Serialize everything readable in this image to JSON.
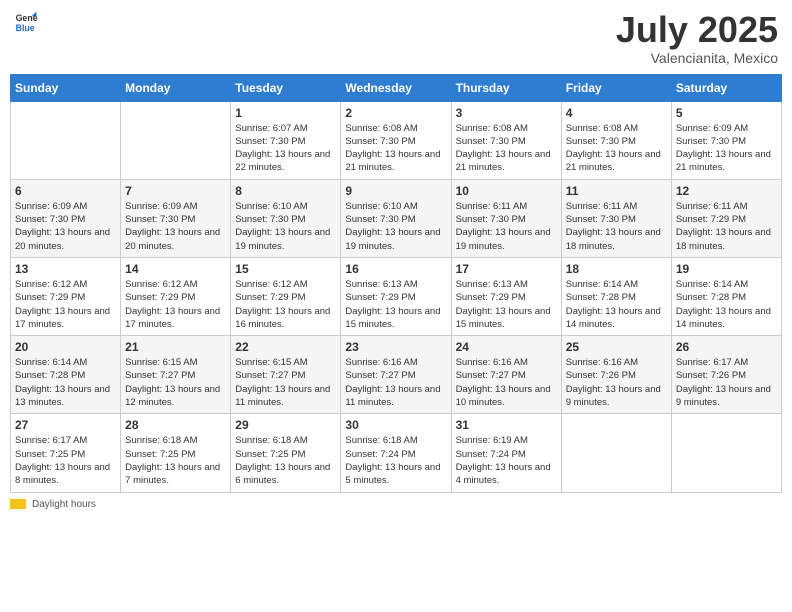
{
  "header": {
    "logo_general": "General",
    "logo_blue": "Blue",
    "month": "July 2025",
    "location": "Valencianita, Mexico"
  },
  "days_of_week": [
    "Sunday",
    "Monday",
    "Tuesday",
    "Wednesday",
    "Thursday",
    "Friday",
    "Saturday"
  ],
  "weeks": [
    [
      {
        "day": "",
        "info": ""
      },
      {
        "day": "",
        "info": ""
      },
      {
        "day": "1",
        "info": "Sunrise: 6:07 AM\nSunset: 7:30 PM\nDaylight: 13 hours and 22 minutes."
      },
      {
        "day": "2",
        "info": "Sunrise: 6:08 AM\nSunset: 7:30 PM\nDaylight: 13 hours and 21 minutes."
      },
      {
        "day": "3",
        "info": "Sunrise: 6:08 AM\nSunset: 7:30 PM\nDaylight: 13 hours and 21 minutes."
      },
      {
        "day": "4",
        "info": "Sunrise: 6:08 AM\nSunset: 7:30 PM\nDaylight: 13 hours and 21 minutes."
      },
      {
        "day": "5",
        "info": "Sunrise: 6:09 AM\nSunset: 7:30 PM\nDaylight: 13 hours and 21 minutes."
      }
    ],
    [
      {
        "day": "6",
        "info": "Sunrise: 6:09 AM\nSunset: 7:30 PM\nDaylight: 13 hours and 20 minutes."
      },
      {
        "day": "7",
        "info": "Sunrise: 6:09 AM\nSunset: 7:30 PM\nDaylight: 13 hours and 20 minutes."
      },
      {
        "day": "8",
        "info": "Sunrise: 6:10 AM\nSunset: 7:30 PM\nDaylight: 13 hours and 19 minutes."
      },
      {
        "day": "9",
        "info": "Sunrise: 6:10 AM\nSunset: 7:30 PM\nDaylight: 13 hours and 19 minutes."
      },
      {
        "day": "10",
        "info": "Sunrise: 6:11 AM\nSunset: 7:30 PM\nDaylight: 13 hours and 19 minutes."
      },
      {
        "day": "11",
        "info": "Sunrise: 6:11 AM\nSunset: 7:30 PM\nDaylight: 13 hours and 18 minutes."
      },
      {
        "day": "12",
        "info": "Sunrise: 6:11 AM\nSunset: 7:29 PM\nDaylight: 13 hours and 18 minutes."
      }
    ],
    [
      {
        "day": "13",
        "info": "Sunrise: 6:12 AM\nSunset: 7:29 PM\nDaylight: 13 hours and 17 minutes."
      },
      {
        "day": "14",
        "info": "Sunrise: 6:12 AM\nSunset: 7:29 PM\nDaylight: 13 hours and 17 minutes."
      },
      {
        "day": "15",
        "info": "Sunrise: 6:12 AM\nSunset: 7:29 PM\nDaylight: 13 hours and 16 minutes."
      },
      {
        "day": "16",
        "info": "Sunrise: 6:13 AM\nSunset: 7:29 PM\nDaylight: 13 hours and 15 minutes."
      },
      {
        "day": "17",
        "info": "Sunrise: 6:13 AM\nSunset: 7:29 PM\nDaylight: 13 hours and 15 minutes."
      },
      {
        "day": "18",
        "info": "Sunrise: 6:14 AM\nSunset: 7:28 PM\nDaylight: 13 hours and 14 minutes."
      },
      {
        "day": "19",
        "info": "Sunrise: 6:14 AM\nSunset: 7:28 PM\nDaylight: 13 hours and 14 minutes."
      }
    ],
    [
      {
        "day": "20",
        "info": "Sunrise: 6:14 AM\nSunset: 7:28 PM\nDaylight: 13 hours and 13 minutes."
      },
      {
        "day": "21",
        "info": "Sunrise: 6:15 AM\nSunset: 7:27 PM\nDaylight: 13 hours and 12 minutes."
      },
      {
        "day": "22",
        "info": "Sunrise: 6:15 AM\nSunset: 7:27 PM\nDaylight: 13 hours and 11 minutes."
      },
      {
        "day": "23",
        "info": "Sunrise: 6:16 AM\nSunset: 7:27 PM\nDaylight: 13 hours and 11 minutes."
      },
      {
        "day": "24",
        "info": "Sunrise: 6:16 AM\nSunset: 7:27 PM\nDaylight: 13 hours and 10 minutes."
      },
      {
        "day": "25",
        "info": "Sunrise: 6:16 AM\nSunset: 7:26 PM\nDaylight: 13 hours and 9 minutes."
      },
      {
        "day": "26",
        "info": "Sunrise: 6:17 AM\nSunset: 7:26 PM\nDaylight: 13 hours and 9 minutes."
      }
    ],
    [
      {
        "day": "27",
        "info": "Sunrise: 6:17 AM\nSunset: 7:25 PM\nDaylight: 13 hours and 8 minutes."
      },
      {
        "day": "28",
        "info": "Sunrise: 6:18 AM\nSunset: 7:25 PM\nDaylight: 13 hours and 7 minutes."
      },
      {
        "day": "29",
        "info": "Sunrise: 6:18 AM\nSunset: 7:25 PM\nDaylight: 13 hours and 6 minutes."
      },
      {
        "day": "30",
        "info": "Sunrise: 6:18 AM\nSunset: 7:24 PM\nDaylight: 13 hours and 5 minutes."
      },
      {
        "day": "31",
        "info": "Sunrise: 6:19 AM\nSunset: 7:24 PM\nDaylight: 13 hours and 4 minutes."
      },
      {
        "day": "",
        "info": ""
      },
      {
        "day": "",
        "info": ""
      }
    ]
  ],
  "footer": {
    "legend_label": "Daylight hours"
  }
}
